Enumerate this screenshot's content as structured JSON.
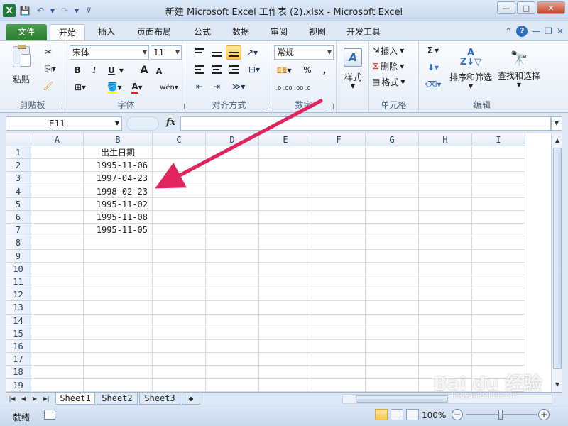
{
  "window": {
    "title": "新建 Microsoft Excel 工作表 (2).xlsx  -  Microsoft Excel",
    "app_icon": "X"
  },
  "ribbon_tabs": [
    "文件",
    "开始",
    "插入",
    "页面布局",
    "公式",
    "数据",
    "审阅",
    "视图",
    "开发工具"
  ],
  "active_tab": "开始",
  "ribbon": {
    "clipboard": {
      "paste": "粘贴",
      "label": "剪贴板"
    },
    "font": {
      "name": "宋体",
      "size": "11",
      "bold": "B",
      "italic": "I",
      "underline": "U",
      "grow": "A",
      "shrink": "A",
      "font_color": "A",
      "phonetic": "wén",
      "label": "字体"
    },
    "alignment": {
      "label": "对齐方式"
    },
    "number": {
      "format": "常规",
      "percent": "%",
      "comma": ",",
      "inc_decimal": ".0 .00",
      "dec_decimal": ".00 .0",
      "label": "数字"
    },
    "styles": {
      "label": "样式"
    },
    "cells": {
      "insert": "插入",
      "delete": "删除",
      "format": "格式",
      "label": "单元格"
    },
    "editing": {
      "sum": "Σ",
      "sort_filter": "排序和筛选",
      "find_select": "查找和选择",
      "label": "编辑"
    }
  },
  "formula_bar": {
    "name_box": "E11",
    "fx": "fx",
    "value": ""
  },
  "columns": [
    "A",
    "B",
    "C",
    "D",
    "E",
    "F",
    "G",
    "H",
    "I"
  ],
  "rows": [
    "1",
    "2",
    "3",
    "4",
    "5",
    "6",
    "7",
    "8",
    "9",
    "10",
    "11",
    "12",
    "13",
    "14",
    "15",
    "16",
    "17",
    "18",
    "19"
  ],
  "cells": {
    "B1": "出生日期",
    "B2": "1995-11-06",
    "B3": "1997-04-23",
    "B4": "1998-02-23",
    "B5": "1995-11-02",
    "B6": "1995-11-08",
    "B7": "1995-11-05"
  },
  "sheets": [
    "Sheet1",
    "Sheet2",
    "Sheet3"
  ],
  "active_sheet": "Sheet1",
  "status_bar": {
    "ready": "就绪",
    "zoom": "100%"
  },
  "watermark": {
    "logo": "Bai du 经验",
    "url": "jingyan.baidu.com"
  },
  "colors": {
    "file_tab": "#2a7b2e",
    "arrow": "#e0245e",
    "selected_button": "#f8c94f"
  }
}
